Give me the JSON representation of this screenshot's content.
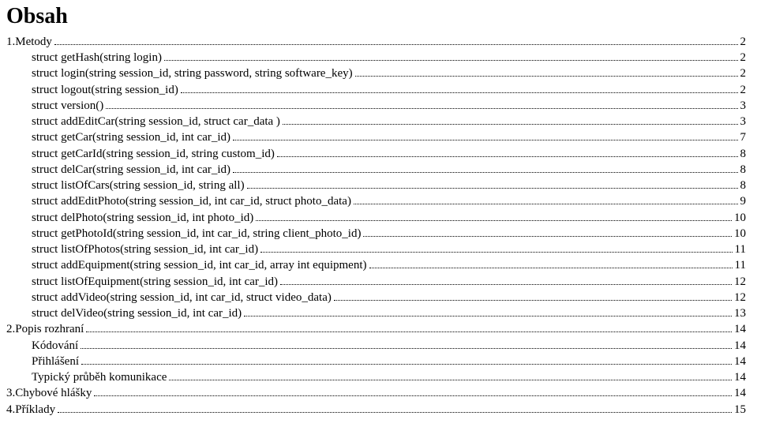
{
  "title": "Obsah",
  "toc": [
    {
      "label": "1.Metody",
      "page": "2",
      "indent": 0
    },
    {
      "label": "struct getHash(string login)",
      "page": "2",
      "indent": 1
    },
    {
      "label": "struct login(string session_id, string password, string software_key)",
      "page": "2",
      "indent": 1
    },
    {
      "label": "struct logout(string session_id)",
      "page": "2",
      "indent": 1
    },
    {
      "label": "struct version()",
      "page": "3",
      "indent": 1
    },
    {
      "label": "struct addEditCar(string session_id, struct car_data )",
      "page": "3",
      "indent": 1
    },
    {
      "label": "struct getCar(string session_id, int car_id)",
      "page": "7",
      "indent": 1
    },
    {
      "label": "struct getCarId(string session_id, string custom_id)",
      "page": "8",
      "indent": 1
    },
    {
      "label": "struct delCar(string session_id, int car_id)",
      "page": "8",
      "indent": 1
    },
    {
      "label": "struct listOfCars(string session_id, string all)",
      "page": "8",
      "indent": 1
    },
    {
      "label": "struct addEditPhoto(string session_id, int car_id, struct photo_data)",
      "page": "9",
      "indent": 1
    },
    {
      "label": "struct delPhoto(string session_id, int photo_id)",
      "page": "10",
      "indent": 1
    },
    {
      "label": "struct getPhotoId(string session_id, int car_id, string client_photo_id)",
      "page": "10",
      "indent": 1
    },
    {
      "label": "struct listOfPhotos(string session_id, int car_id)",
      "page": "11",
      "indent": 1
    },
    {
      "label": "struct addEquipment(string session_id, int car_id, array int equipment)",
      "page": "11",
      "indent": 1
    },
    {
      "label": "struct listOfEquipment(string session_id, int car_id)",
      "page": "12",
      "indent": 1
    },
    {
      "label": "struct addVideo(string session_id, int car_id, struct video_data)",
      "page": "12",
      "indent": 1
    },
    {
      "label": "struct delVideo(string session_id, int car_id)",
      "page": "13",
      "indent": 1
    },
    {
      "label": "2.Popis rozhraní",
      "page": "14",
      "indent": 0
    },
    {
      "label": "Kódování",
      "page": "14",
      "indent": 1
    },
    {
      "label": "Přihlášení",
      "page": "14",
      "indent": 1
    },
    {
      "label": "Typický průběh komunikace",
      "page": "14",
      "indent": 1
    },
    {
      "label": "3.Chybové hlášky",
      "page": "14",
      "indent": 0
    },
    {
      "label": "4.Příklady",
      "page": "15",
      "indent": 0
    }
  ]
}
